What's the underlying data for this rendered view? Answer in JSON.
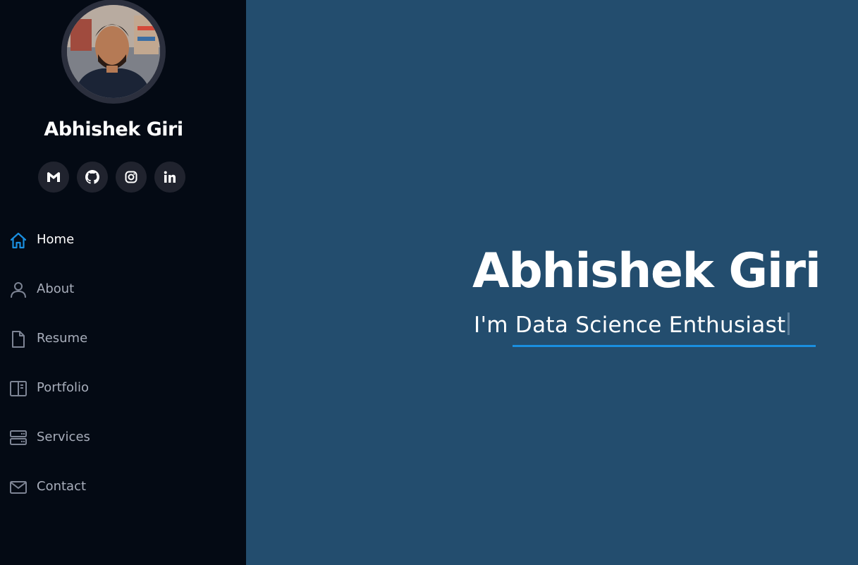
{
  "profile": {
    "name": "Abhishek Giri",
    "avatar_alt": "Profile photo"
  },
  "socials": [
    {
      "icon": "gmail-icon",
      "label": "Gmail"
    },
    {
      "icon": "github-icon",
      "label": "GitHub"
    },
    {
      "icon": "instagram-icon",
      "label": "Instagram"
    },
    {
      "icon": "linkedin-icon",
      "label": "LinkedIn"
    }
  ],
  "nav": {
    "items": [
      {
        "label": "Home",
        "icon": "home-icon",
        "active": true
      },
      {
        "label": "About",
        "icon": "person-icon",
        "active": false
      },
      {
        "label": "Resume",
        "icon": "file-icon",
        "active": false
      },
      {
        "label": "Portfolio",
        "icon": "layout-icon",
        "active": false
      },
      {
        "label": "Services",
        "icon": "server-icon",
        "active": false
      },
      {
        "label": "Contact",
        "icon": "envelope-icon",
        "active": false
      }
    ]
  },
  "hero": {
    "title": "Abhishek Giri",
    "prefix": "I'm",
    "typed": "Data Science Enthusiast"
  },
  "colors": {
    "sidebar_bg": "#040a14",
    "main_bg": "#234d6e",
    "accent": "#1a8fe0",
    "nav_text": "#a8aebb"
  }
}
